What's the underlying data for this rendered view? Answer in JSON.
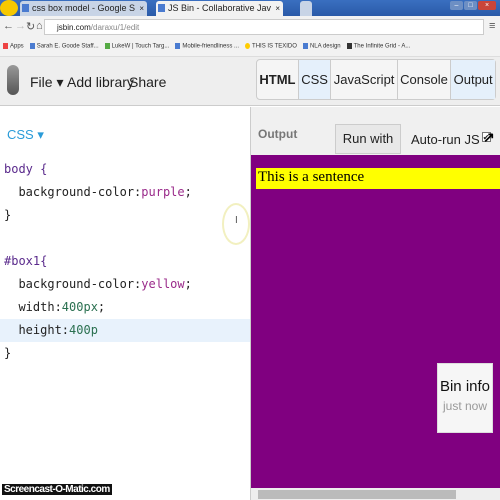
{
  "browser": {
    "tabs": [
      {
        "label": "css box model - Google S",
        "active": false
      },
      {
        "label": "JS Bin - Collaborative Jav",
        "active": true
      }
    ],
    "url_host": "jsbin.com",
    "url_path": "/daraxu/1/edit",
    "bookmarks": [
      "Apps",
      "Sarah E. Goode Staff...",
      "LukeW | Touch Targ...",
      "Mobile-friendliness ...",
      "THIS IS TEXIDO",
      "NLA design",
      "The Infinite Grid - A..."
    ]
  },
  "header": {
    "menu": {
      "file": "File ▾",
      "add_library": "Add library",
      "share": "Share"
    },
    "panel_tabs": [
      {
        "label": "HTML",
        "active": false
      },
      {
        "label": "CSS",
        "active": true
      },
      {
        "label": "JavaScript",
        "active": false
      },
      {
        "label": "Console",
        "active": false
      },
      {
        "label": "Output",
        "active": true
      }
    ]
  },
  "editor": {
    "language": "CSS ▾",
    "lines": [
      [
        "body {",
        "",
        ""
      ],
      [
        "  background-color:",
        "purple",
        ";"
      ],
      [
        "}",
        "",
        ""
      ],
      [
        "",
        "",
        ""
      ],
      [
        "#box1{",
        "",
        ""
      ],
      [
        "  background-color:",
        "yellow",
        ";"
      ],
      [
        "  width:",
        "400px",
        ";"
      ],
      [
        "  height:",
        "400p",
        ""
      ],
      [
        "}",
        "",
        ""
      ]
    ]
  },
  "output": {
    "label": "Output",
    "run_button": "Run with JS",
    "auto_run": "Auto-run JS",
    "auto_run_checked": true,
    "body_color": "#800080",
    "box_color": "#ffff00",
    "sentence": "This is a sentence",
    "bin_info": {
      "title": "Bin info",
      "subtitle": "just now"
    }
  },
  "watermark": "Screencast-O-Matic.com"
}
